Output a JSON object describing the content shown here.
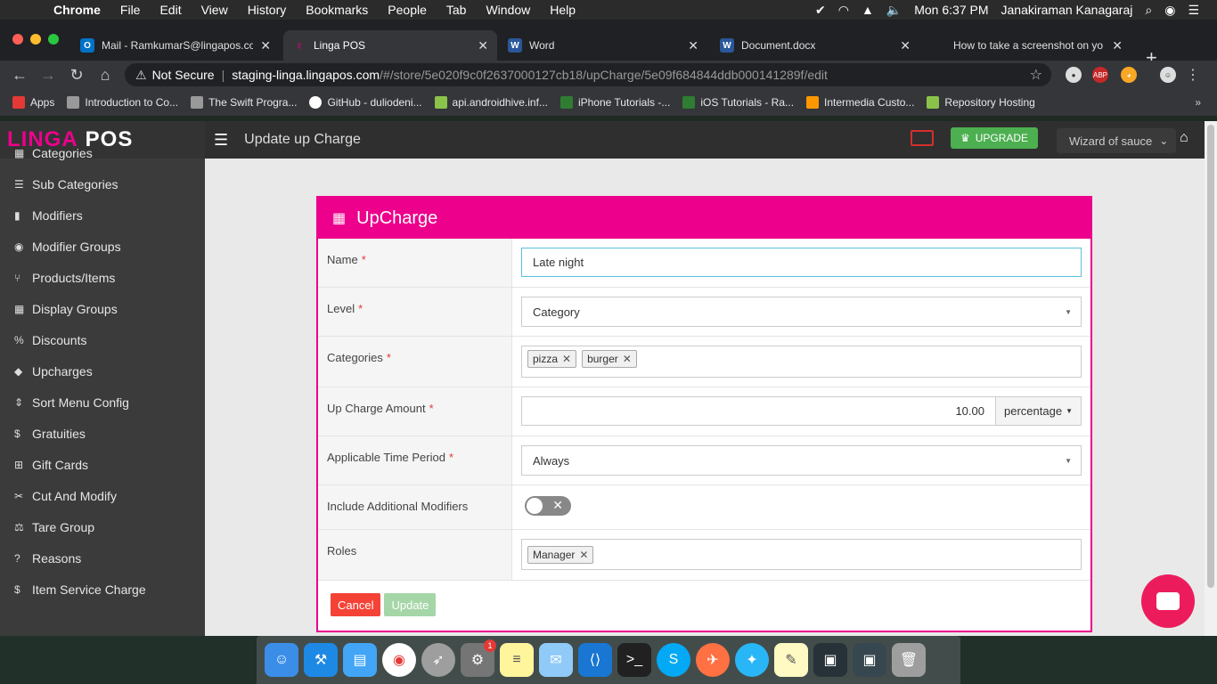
{
  "menubar": {
    "app": "Chrome",
    "items": [
      "File",
      "Edit",
      "View",
      "History",
      "Bookmarks",
      "People",
      "Tab",
      "Window",
      "Help"
    ],
    "clock": "Mon 6:37 PM",
    "user": "Janakiraman Kanagaraj"
  },
  "tabs": [
    {
      "title": "Mail - RamkumarS@lingapos.co",
      "fav_letter": "O",
      "fav_color": "#0072c6"
    },
    {
      "title": "Linga POS",
      "fav_letter": "",
      "fav_color": "#ec008c"
    },
    {
      "title": "Word",
      "fav_letter": "W",
      "fav_color": "#2b579a"
    },
    {
      "title": "Document.docx",
      "fav_letter": "W",
      "fav_color": "#2b579a"
    },
    {
      "title": "How to take a screenshot on yo",
      "fav_letter": "",
      "fav_color": "#666666"
    }
  ],
  "address": {
    "security": "Not Secure",
    "host": "staging-linga.lingapos.com",
    "path": "/#/store/5e020f9c0f2637000127cb18/upCharge/5e09f684844ddb000141289f/edit"
  },
  "bookmarks": [
    {
      "label": "Apps",
      "color": "#e53935"
    },
    {
      "label": "Introduction to Co...",
      "color": "#999999"
    },
    {
      "label": "The Swift Progra...",
      "color": "#999999"
    },
    {
      "label": "GitHub - duliodeni...",
      "color": "#ffffff"
    },
    {
      "label": "api.androidhive.inf...",
      "color": "#8bc34a"
    },
    {
      "label": "iPhone Tutorials -...",
      "color": "#2e7d32"
    },
    {
      "label": "iOS Tutorials - Ra...",
      "color": "#2e7d32"
    },
    {
      "label": "Intermedia Custo...",
      "color": "#ff9800"
    },
    {
      "label": "Repository Hosting",
      "color": "#8bc34a"
    }
  ],
  "logo": {
    "part1": "LINGA",
    "part2": "POS"
  },
  "sidebar": {
    "items": [
      {
        "label": "Categories",
        "icon": "▦"
      },
      {
        "label": "Sub Categories",
        "icon": "☰"
      },
      {
        "label": "Modifiers",
        "icon": "▮"
      },
      {
        "label": "Modifier Groups",
        "icon": "◉"
      },
      {
        "label": "Products/Items",
        "icon": "⑂"
      },
      {
        "label": "Display Groups",
        "icon": "▦"
      },
      {
        "label": "Discounts",
        "icon": "%"
      },
      {
        "label": "Upcharges",
        "icon": "◆"
      },
      {
        "label": "Sort Menu Config",
        "icon": "⇕"
      },
      {
        "label": "Gratuities",
        "icon": "$"
      },
      {
        "label": "Gift Cards",
        "icon": "⊞"
      },
      {
        "label": "Cut And Modify",
        "icon": "✂"
      },
      {
        "label": "Tare Group",
        "icon": "⚖"
      },
      {
        "label": "Reasons",
        "icon": "?"
      },
      {
        "label": "Item Service Charge",
        "icon": "$"
      }
    ]
  },
  "topbar": {
    "title": "Update up Charge",
    "upgrade": "UPGRADE",
    "store": "Wizard of sauce"
  },
  "panel": {
    "title": "UpCharge",
    "name_label": "Name",
    "name_value": "Late night",
    "level_label": "Level",
    "level_value": "Category",
    "categories_label": "Categories",
    "categories": [
      "pizza",
      "burger"
    ],
    "amount_label": "Up Charge Amount",
    "amount_value": "10.00",
    "amount_unit": "percentage",
    "period_label": "Applicable Time Period",
    "period_value": "Always",
    "modifiers_label": "Include Additional Modifiers",
    "roles_label": "Roles",
    "roles": [
      "Manager"
    ],
    "cancel": "Cancel",
    "update": "Update"
  }
}
